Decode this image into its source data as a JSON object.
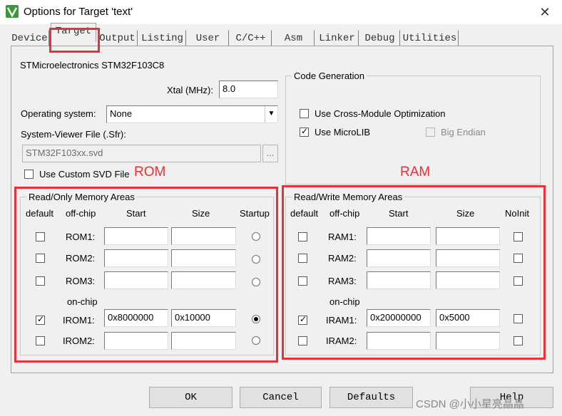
{
  "window": {
    "title": "Options for Target 'text'",
    "close_glyph": "✕"
  },
  "tabs": [
    "Device",
    "Target",
    "Output",
    "Listing",
    "User",
    "C/C++",
    "Asm",
    "Linker",
    "Debug",
    "Utilities"
  ],
  "active_tab": "Target",
  "device_name": "STMicroelectronics STM32F103C8",
  "xtal": {
    "label": "Xtal (MHz):",
    "value": "8.0"
  },
  "os": {
    "label": "Operating system:",
    "value": "None"
  },
  "sfr": {
    "label": "System-Viewer File (.Sfr):",
    "value": "STM32F103xx.svd",
    "browse": "..."
  },
  "custom_svd": {
    "label": "Use Custom SVD File",
    "checked": false
  },
  "code_gen": {
    "title": "Code Generation",
    "cross_module": {
      "label": "Use Cross-Module Optimization",
      "checked": false
    },
    "microlib": {
      "label": "Use MicroLIB",
      "checked": true
    },
    "big_endian": {
      "label": "Big Endian",
      "checked": false
    }
  },
  "annotations": {
    "rom": "ROM",
    "ram": "RAM"
  },
  "rom_group": {
    "title": "Read/Only Memory Areas",
    "headers": {
      "default": "default",
      "offchip": "off-chip",
      "start": "Start",
      "size": "Size",
      "startup": "Startup"
    },
    "onchip_label": "on-chip",
    "rows": [
      {
        "name": "ROM1:",
        "default": false,
        "start": "",
        "size": "",
        "startup": false
      },
      {
        "name": "ROM2:",
        "default": false,
        "start": "",
        "size": "",
        "startup": false
      },
      {
        "name": "ROM3:",
        "default": false,
        "start": "",
        "size": "",
        "startup": false
      },
      {
        "name": "IROM1:",
        "default": true,
        "start": "0x8000000",
        "size": "0x10000",
        "startup": true
      },
      {
        "name": "IROM2:",
        "default": false,
        "start": "",
        "size": "",
        "startup": false
      }
    ]
  },
  "ram_group": {
    "title": "Read/Write Memory Areas",
    "headers": {
      "default": "default",
      "offchip": "off-chip",
      "start": "Start",
      "size": "Size",
      "noinit": "NoInit"
    },
    "onchip_label": "on-chip",
    "rows": [
      {
        "name": "RAM1:",
        "default": false,
        "start": "",
        "size": "",
        "noinit": false
      },
      {
        "name": "RAM2:",
        "default": false,
        "start": "",
        "size": "",
        "noinit": false
      },
      {
        "name": "RAM3:",
        "default": false,
        "start": "",
        "size": "",
        "noinit": false
      },
      {
        "name": "IRAM1:",
        "default": true,
        "start": "0x20000000",
        "size": "0x5000",
        "noinit": false
      },
      {
        "name": "IRAM2:",
        "default": false,
        "start": "",
        "size": "",
        "noinit": false
      }
    ]
  },
  "buttons": {
    "ok": "OK",
    "cancel": "Cancel",
    "defaults": "Defaults",
    "help": "Help"
  },
  "watermark": "CSDN @小小星亮晶晶",
  "colors": {
    "highlight": "#e8313a",
    "dialog_bg": "#f0f0f0"
  }
}
